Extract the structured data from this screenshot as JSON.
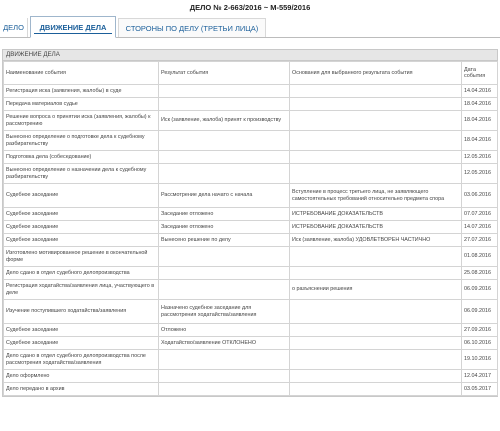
{
  "case_title": "ДЕЛО № 2-663/2016 ~ М-559/2016",
  "tabs": [
    {
      "label": "ДЕЛО"
    },
    {
      "label": "ДВИЖЕНИЕ ДЕЛА"
    },
    {
      "label": "СТОРОНЫ ПО ДЕЛУ (ТРЕТЬИ ЛИЦА)"
    }
  ],
  "section_title": "ДВИЖЕНИЕ ДЕЛА",
  "columns": [
    "Наименование события",
    "Результат события",
    "Основания для выбранного результата события",
    "Дата события"
  ],
  "rows": [
    {
      "event": "Регистрация иска (заявления, жалобы) в суде",
      "result": "",
      "basis": "",
      "date": "14.04.2016"
    },
    {
      "event": "Передача материалов судье",
      "result": "",
      "basis": "",
      "date": "18.04.2016"
    },
    {
      "event": "Решение вопроса о принятии иска (заявления, жалобы) к рассмотрению",
      "result": "Иск (заявление, жалоба) принят к производству",
      "basis": "",
      "date": "18.04.2016"
    },
    {
      "event": "Вынесено определение о подготовке дела к судебному разбирательству",
      "result": "",
      "basis": "",
      "date": "18.04.2016"
    },
    {
      "event": "Подготовка дела (собеседование)",
      "result": "",
      "basis": "",
      "date": "12.05.2016"
    },
    {
      "event": "Вынесено определение о назначении дела к судебному разбирательству",
      "result": "",
      "basis": "",
      "date": "12.05.2016"
    },
    {
      "event": "Судебное заседание",
      "result": "Рассмотрение дела начато с начала",
      "basis": "Вступление в процесс третьего лица, не заявляющего самостоятельных требований относительно предмета спора",
      "date": "03.06.2016"
    },
    {
      "event": "Судебное заседание",
      "result": "Заседание отложено",
      "basis": "ИСТРЕБОВАНИЕ ДОКАЗАТЕЛЬСТВ",
      "date": "07.07.2016"
    },
    {
      "event": "Судебное заседание",
      "result": "Заседание отложено",
      "basis": "ИСТРЕБОВАНИЕ ДОКАЗАТЕЛЬСТВ",
      "date": "14.07.2016"
    },
    {
      "event": "Судебное заседание",
      "result": "Вынесено решение по делу",
      "basis": "Иск (заявление, жалоба) УДОВЛЕТВОРЕН ЧАСТИЧНО",
      "date": "27.07.2016"
    },
    {
      "event": "Изготовлено мотивированное решение в окончательной форме",
      "result": "",
      "basis": "",
      "date": "01.08.2016"
    },
    {
      "event": "Дело сдано в отдел судебного делопроизводства",
      "result": "",
      "basis": "",
      "date": "25.08.2016"
    },
    {
      "event": "Регистрация ходатайства/заявления лица, участвующего в деле",
      "result": "",
      "basis": "о разъяснении решения",
      "date": "06.09.2016"
    },
    {
      "event": "Изучение поступившего ходатайства/заявления",
      "result": "Назначено судебное заседание для рассмотрения ходатайства/заявления",
      "basis": "",
      "date": "06.09.2016"
    },
    {
      "event": "Судебное заседание",
      "result": "Отложено",
      "basis": "",
      "date": "27.09.2016"
    },
    {
      "event": "Судебное заседание",
      "result": "Ходатайство/заявление ОТКЛОНЕНО",
      "basis": "",
      "date": "06.10.2016"
    },
    {
      "event": "Дело сдано в отдел судебного делопроизводства после рассмотрения ходатайства/заявления",
      "result": "",
      "basis": "",
      "date": "19.10.2016"
    },
    {
      "event": "Дело оформлено",
      "result": "",
      "basis": "",
      "date": "12.04.2017"
    },
    {
      "event": "Дело передано в архив",
      "result": "",
      "basis": "",
      "date": "03.05.2017"
    }
  ]
}
